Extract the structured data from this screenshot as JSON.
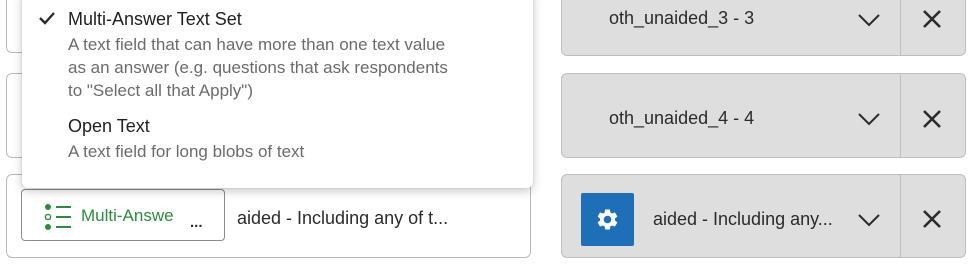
{
  "colors": {
    "accent_green": "#2f8a3f",
    "gear_blue": "#1e6fb8",
    "card_gray": "#dedede"
  },
  "dropdown": {
    "items": [
      {
        "title": "Multi-Answer Text Set",
        "desc_lines": [
          "A text field that can have more than one text value",
          "as an answer (e.g. questions that ask respondents",
          "to \"Select all that Apply\")"
        ],
        "selected": true,
        "icon": "checkmark-icon"
      },
      {
        "title": "Open Text",
        "desc_lines": [
          "A text field for long blobs of text"
        ],
        "selected": false
      }
    ]
  },
  "left_rows": [
    {},
    {},
    {
      "type_label": "Multi-Answe",
      "type_more": "...",
      "type_icon": "multi-answer-list-icon",
      "field_label": "aided - Including any of t..."
    }
  ],
  "right_rows": [
    {
      "text": "oth_unaided_3 - 3",
      "chevron_icon": "chevron-down-icon",
      "close_icon": "close-icon"
    },
    {
      "text": "oth_unaided_4 - 4",
      "chevron_icon": "chevron-down-icon",
      "close_icon": "close-icon"
    },
    {
      "text": "aided - Including any...",
      "chevron_icon": "chevron-down-icon",
      "close_icon": "close-icon",
      "action_icon": "gear-icon"
    }
  ]
}
